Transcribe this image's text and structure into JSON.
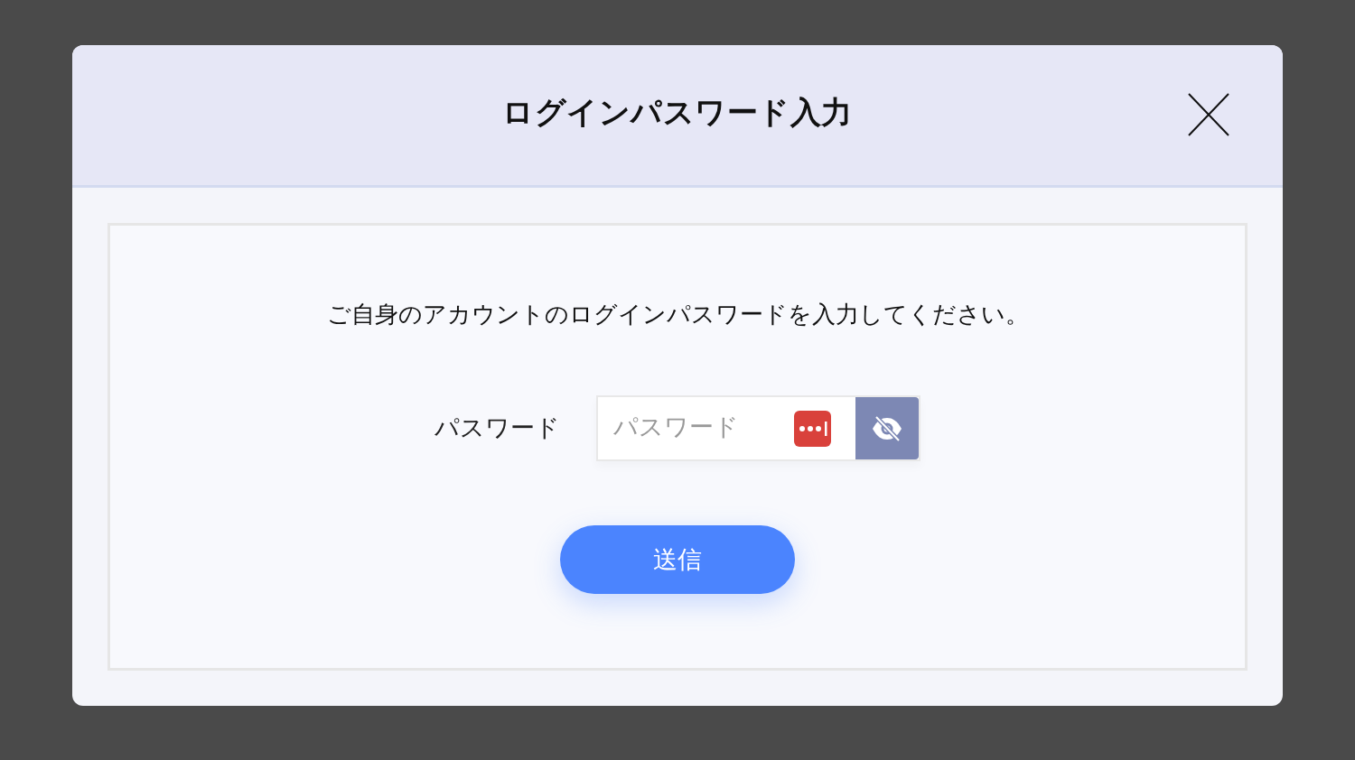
{
  "dialog": {
    "title": "ログインパスワード入力",
    "instruction": "ご自身のアカウントのログインパスワードを入力してください。",
    "password_field": {
      "label": "パスワード",
      "placeholder": "パスワード"
    },
    "submit_button": "送信"
  }
}
